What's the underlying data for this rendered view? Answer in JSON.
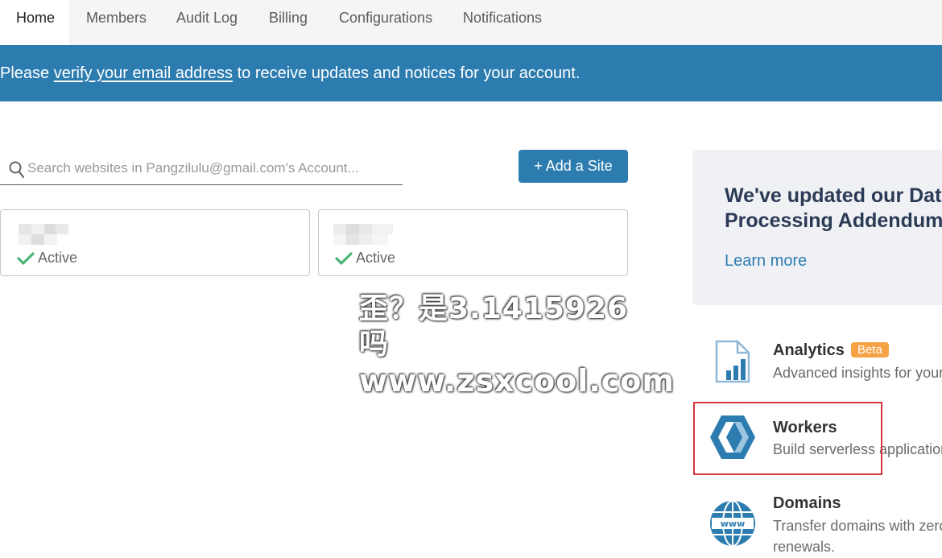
{
  "tabs": [
    {
      "label": "Home",
      "active": true
    },
    {
      "label": "Members",
      "active": false
    },
    {
      "label": "Audit Log",
      "active": false
    },
    {
      "label": "Billing",
      "active": false
    },
    {
      "label": "Configurations",
      "active": false
    },
    {
      "label": "Notifications",
      "active": false
    }
  ],
  "banner": {
    "prefix": "Please ",
    "link": "verify your email address",
    "suffix": " to receive updates and notices for your account."
  },
  "search": {
    "placeholder": "Search websites in Pangzilulu@gmail.com's Account...",
    "value": ""
  },
  "add_site_label": "+ Add a Site",
  "sites": [
    {
      "name": "",
      "status": "Active"
    },
    {
      "name": "",
      "status": "Active"
    }
  ],
  "watermark": {
    "line1": "歪？是3.1415926吗",
    "line2": "www.zsxcool.com"
  },
  "promo": {
    "title_line1": "We've updated our Data",
    "title_line2": "Processing Addendum",
    "link": "Learn more"
  },
  "products": [
    {
      "title": "Analytics",
      "badge": "Beta",
      "desc": "Advanced insights for your",
      "icon": "analytics-icon"
    },
    {
      "title": "Workers",
      "desc": "Build serverless applications",
      "icon": "workers-icon"
    },
    {
      "title": "Domains",
      "desc": "Transfer domains with zero",
      "desc2": "renewals.",
      "icon": "www-globe-icon"
    }
  ],
  "colors": {
    "brand_blue": "#2c7cb0",
    "active_green": "#4cb377",
    "beta_orange": "#f6a144",
    "highlight_red": "#d8363a"
  }
}
